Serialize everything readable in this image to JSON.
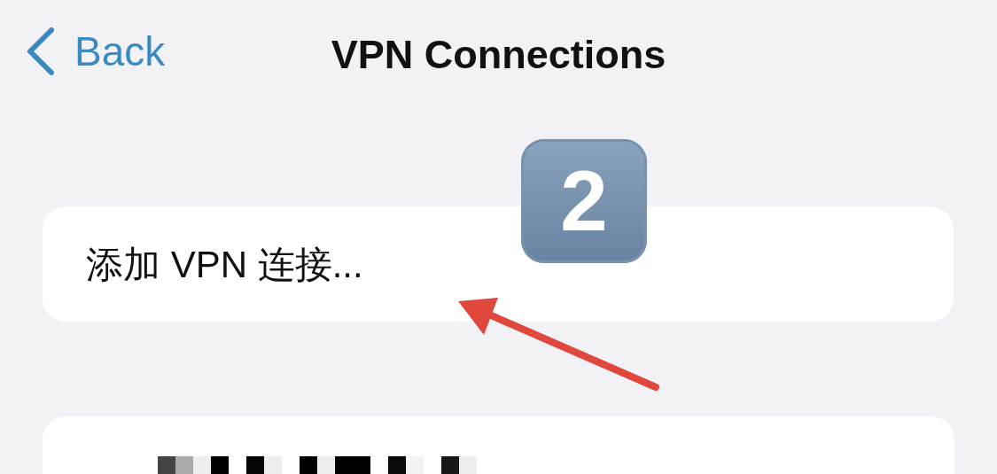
{
  "nav": {
    "back_label": "Back",
    "title": "VPN Connections"
  },
  "step_badge": "2",
  "add_row": {
    "label": "添加 VPN 连接..."
  },
  "connections": [
    {
      "kind": "redacted"
    }
  ]
}
